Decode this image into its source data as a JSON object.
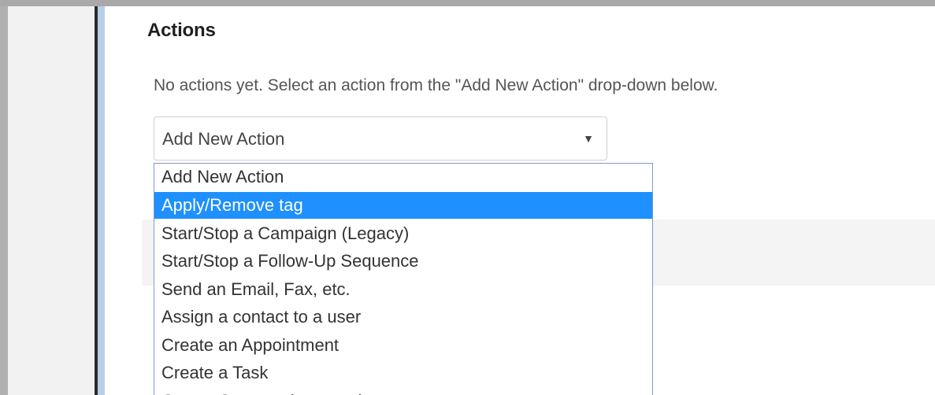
{
  "section": {
    "title": "Actions",
    "hint": "No actions yet. Select an action from the \"Add New Action\" drop-down below."
  },
  "select": {
    "value": "Add New Action",
    "arrow": "▼"
  },
  "dropdown": {
    "options": [
      "Add New Action",
      "Apply/Remove tag",
      "Start/Stop a Campaign (Legacy)",
      "Start/Stop a Follow-Up Sequence",
      "Send an Email, Fax, etc.",
      "Assign a contact to a user",
      "Create an Appointment",
      "Create a Task",
      "Create Opportunity record"
    ],
    "highlighted": "Apply/Remove tag"
  },
  "colors": {
    "highlight": "#1e90ff",
    "dropdown_border": "#7a9cc6",
    "accent_bar": "#b8cfe8"
  }
}
